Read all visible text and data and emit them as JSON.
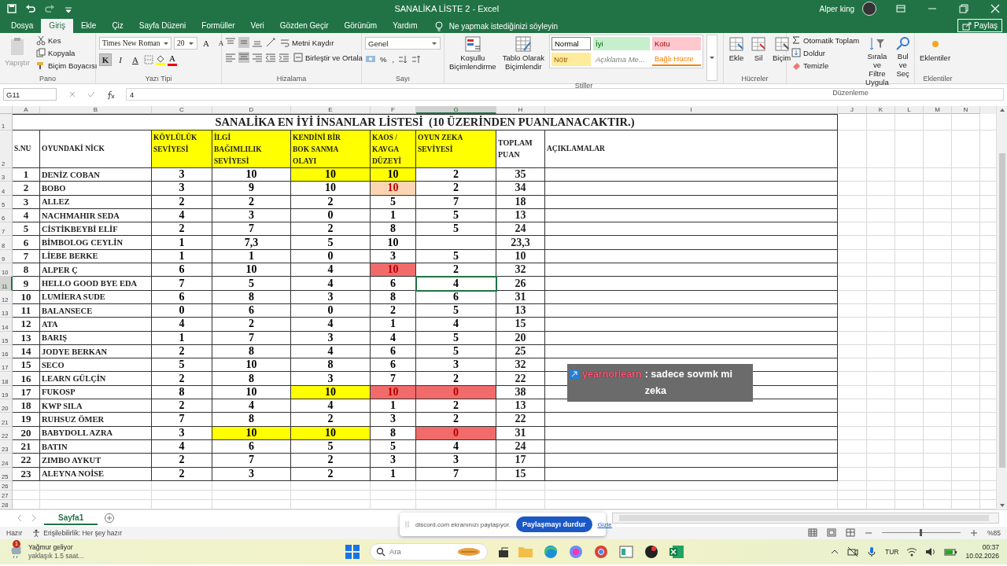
{
  "title_bar": {
    "title": "SANALİKA LİSTE 2  -  Excel",
    "user": "Alper king"
  },
  "ribbon_tabs": [
    {
      "label": "Dosya",
      "selected": false
    },
    {
      "label": "Giriş",
      "selected": true
    },
    {
      "label": "Ekle",
      "selected": false
    },
    {
      "label": "Çiz",
      "selected": false
    },
    {
      "label": "Sayfa Düzeni",
      "selected": false
    },
    {
      "label": "Formüller",
      "selected": false
    },
    {
      "label": "Veri",
      "selected": false
    },
    {
      "label": "Gözden Geçir",
      "selected": false
    },
    {
      "label": "Görünüm",
      "selected": false
    },
    {
      "label": "Yardım",
      "selected": false
    }
  ],
  "tell_me": "Ne yapmak istediğinizi söyleyin",
  "share_button": "Paylaş",
  "ribbon": {
    "clipboard": {
      "label": "Pano",
      "paste": {
        "label": "Yapıştır",
        "disabled": true
      },
      "cut": "Kes",
      "copy": "Kopyala",
      "format_painter": "Biçim Boyacısı"
    },
    "font": {
      "label": "Yazı Tipi",
      "family": "Times New Roman",
      "size": "20",
      "grow": "A",
      "shrink": "A",
      "format_buttons": [
        {
          "label": "K",
          "kind": "bold",
          "pressed": true
        },
        {
          "label": "I",
          "kind": "italic",
          "pressed": false
        },
        {
          "label": "A",
          "kind": "underline",
          "pressed": false
        }
      ],
      "font_color": "A"
    },
    "alignment": {
      "label": "Hizalama",
      "wrap": "Metni Kaydır",
      "merge": "Birleştir ve Ortala"
    },
    "number": {
      "label": "Sayı",
      "format": "Genel",
      "percent": "%",
      "comma": ","
    },
    "styles": {
      "label": "Stiller",
      "conditional": "Koşullu\nBiçimlendirme",
      "table": "Tablo Olarak\nBiçimlendir",
      "gallery": [
        {
          "label": "Normal",
          "kind": "normal"
        },
        {
          "label": "İyi",
          "kind": "good"
        },
        {
          "label": "Kotu",
          "kind": "bad"
        },
        {
          "label": "Nötr",
          "kind": "neutral"
        },
        {
          "label": "Açıklama Me...",
          "kind": "note"
        },
        {
          "label": "Bağlı Hücre",
          "kind": "linked"
        }
      ]
    },
    "cells": {
      "label": "Hücreler",
      "insert": "Ekle",
      "delete": "Sil",
      "format": "Biçim"
    },
    "editing": {
      "label": "Düzenleme",
      "autosum": "Otomatik Toplam",
      "fill": "Doldur",
      "clear": "Temizle",
      "sort": "Sırala ve Filtre\nUygula",
      "find": "Bul ve\nSeç"
    },
    "addins": {
      "label": "Eklentiler",
      "button": "Eklentiler"
    }
  },
  "formula_bar": {
    "name_box": "G11",
    "value": "4"
  },
  "columns": [
    {
      "label": "A",
      "selected": false
    },
    {
      "label": "B",
      "selected": false
    },
    {
      "label": "C",
      "selected": false
    },
    {
      "label": "D",
      "selected": false
    },
    {
      "label": "E",
      "selected": false
    },
    {
      "label": "F",
      "selected": false
    },
    {
      "label": "G",
      "selected": true
    },
    {
      "label": "H",
      "selected": false
    },
    {
      "label": "I",
      "selected": false
    },
    {
      "label": "J",
      "selected": false
    },
    {
      "label": "K",
      "selected": false
    },
    {
      "label": "L",
      "selected": false
    },
    {
      "label": "M",
      "selected": false
    },
    {
      "label": "N",
      "selected": false
    }
  ],
  "row_numbers": [
    {
      "label": "1",
      "selected": false
    },
    {
      "label": "2",
      "selected": false
    },
    {
      "label": "3",
      "selected": false
    },
    {
      "label": "4",
      "selected": false
    },
    {
      "label": "5",
      "selected": false
    },
    {
      "label": "6",
      "selected": false
    },
    {
      "label": "7",
      "selected": false
    },
    {
      "label": "8",
      "selected": false
    },
    {
      "label": "9",
      "selected": false
    },
    {
      "label": "10",
      "selected": false
    },
    {
      "label": "11",
      "selected": true
    },
    {
      "label": "12",
      "selected": false
    },
    {
      "label": "13",
      "selected": false
    },
    {
      "label": "14",
      "selected": false
    },
    {
      "label": "15",
      "selected": false
    },
    {
      "label": "16",
      "selected": false
    },
    {
      "label": "17",
      "selected": false
    },
    {
      "label": "18",
      "selected": false
    },
    {
      "label": "19",
      "selected": false
    },
    {
      "label": "20",
      "selected": false
    },
    {
      "label": "21",
      "selected": false
    },
    {
      "label": "22",
      "selected": false
    },
    {
      "label": "23",
      "selected": false
    },
    {
      "label": "24",
      "selected": false
    },
    {
      "label": "25",
      "selected": false
    },
    {
      "label": "26",
      "selected": false
    },
    {
      "label": "27",
      "selected": false
    },
    {
      "label": "28",
      "selected": false
    }
  ],
  "sheet": {
    "title": "SANALİKA EN İYİ İNSANLAR LİSTESİ  (10 ÜZERİNDEN PUANLANACAKTIR.)",
    "headers": [
      {
        "text": "S.NU"
      },
      {
        "text": "OYUNDAKİ NİCK"
      },
      {
        "text": "KÖYLÜLÜK\nSEVİYESİ",
        "color": "#ffff00"
      },
      {
        "text": "İLGİ\nBAĞIMLILIK\nSEVİYESİ",
        "color": "#ffff00"
      },
      {
        "text": "KENDİNİ BİR\nBOK SANMA\nOLAYI",
        "color": "#ffff00"
      },
      {
        "text": "KAOS /\nKAVGA\nDÜZEYİ",
        "color": "#ffff00"
      },
      {
        "text": "OYUN ZEKA\nSEVİYESİ",
        "color": "#ffff00"
      },
      {
        "text": "TOPLAM\nPUAN"
      },
      {
        "text": "AÇIKLAMALAR"
      }
    ],
    "rows": [
      {
        "no": "1",
        "nick": "DENİZ COBAN",
        "total": "35",
        "scores": [
          {
            "value": "3",
            "selected": false
          },
          {
            "value": "10",
            "selected": false
          },
          {
            "value": "10",
            "color": "#ffff00",
            "selected": false
          },
          {
            "value": "10",
            "color": "#ffff00",
            "selected": false
          },
          {
            "value": "2",
            "selected": false
          }
        ]
      },
      {
        "no": "2",
        "nick": "BOBO",
        "total": "34",
        "scores": [
          {
            "value": "3",
            "selected": false
          },
          {
            "value": "9",
            "selected": false
          },
          {
            "value": "10",
            "selected": false
          },
          {
            "value": "10",
            "color": "#fcd5b4",
            "selected": false
          },
          {
            "value": "2",
            "selected": false
          }
        ]
      },
      {
        "no": "3",
        "nick": "ALLEZ",
        "total": "18",
        "scores": [
          {
            "value": "2",
            "selected": false
          },
          {
            "value": "2",
            "selected": false
          },
          {
            "value": "2",
            "selected": false
          },
          {
            "value": "5",
            "selected": false
          },
          {
            "value": "7",
            "selected": false
          }
        ]
      },
      {
        "no": "4",
        "nick": "NACHMAHIR SEDA",
        "total": "13",
        "scores": [
          {
            "value": "4",
            "selected": false
          },
          {
            "value": "3",
            "selected": false
          },
          {
            "value": "0",
            "selected": false
          },
          {
            "value": "1",
            "selected": false
          },
          {
            "value": "5",
            "selected": false
          }
        ]
      },
      {
        "no": "5",
        "nick": "CİSTİKBEYBİ ELİF",
        "total": "24",
        "scores": [
          {
            "value": "2",
            "selected": false
          },
          {
            "value": "7",
            "selected": false
          },
          {
            "value": "2",
            "selected": false
          },
          {
            "value": "8",
            "selected": false
          },
          {
            "value": "5",
            "selected": false
          }
        ]
      },
      {
        "no": "6",
        "nick": "BİMBOLOG CEYLİN",
        "total": "23,3",
        "scores": [
          {
            "value": "1",
            "selected": false
          },
          {
            "value": "7,3",
            "selected": false
          },
          {
            "value": "5",
            "selected": false
          },
          {
            "value": "10",
            "selected": false
          },
          {
            "selected": false
          }
        ]
      },
      {
        "no": "7",
        "nick": "LİEBE BERKE",
        "total": "10",
        "scores": [
          {
            "value": "1",
            "selected": false
          },
          {
            "value": "1",
            "selected": false
          },
          {
            "value": "0",
            "selected": false
          },
          {
            "value": "3",
            "selected": false
          },
          {
            "value": "5",
            "selected": false
          }
        ]
      },
      {
        "no": "8",
        "nick": "ALPER Ç",
        "total": "32",
        "scores": [
          {
            "value": "6",
            "selected": false
          },
          {
            "value": "10",
            "selected": false
          },
          {
            "value": "4",
            "selected": false
          },
          {
            "value": "10",
            "color": "#f26b6b",
            "selected": false
          },
          {
            "value": "2",
            "selected": false
          }
        ]
      },
      {
        "no": "9",
        "nick": "HELLO GOOD BYE EDA",
        "total": "26",
        "scores": [
          {
            "value": "7",
            "selected": false
          },
          {
            "value": "5",
            "selected": false
          },
          {
            "value": "4",
            "selected": false
          },
          {
            "value": "6",
            "selected": false
          },
          {
            "value": "4",
            "selected": true
          }
        ]
      },
      {
        "no": "10",
        "nick": "LUMİERA SUDE",
        "total": "31",
        "scores": [
          {
            "value": "6",
            "selected": false
          },
          {
            "value": "8",
            "selected": false
          },
          {
            "value": "3",
            "selected": false
          },
          {
            "value": "8",
            "selected": false
          },
          {
            "value": "6",
            "selected": false
          }
        ]
      },
      {
        "no": "11",
        "nick": "BALANSECE",
        "total": "13",
        "scores": [
          {
            "value": "0",
            "selected": false
          },
          {
            "value": "6",
            "selected": false
          },
          {
            "value": "0",
            "selected": false
          },
          {
            "value": "2",
            "selected": false
          },
          {
            "value": "5",
            "selected": false
          }
        ]
      },
      {
        "no": "12",
        "nick": "ATA",
        "total": "15",
        "scores": [
          {
            "value": "4",
            "selected": false
          },
          {
            "value": "2",
            "selected": false
          },
          {
            "value": "4",
            "selected": false
          },
          {
            "value": "1",
            "selected": false
          },
          {
            "value": "4",
            "selected": false
          }
        ]
      },
      {
        "no": "13",
        "nick": "BARIŞ",
        "total": "20",
        "scores": [
          {
            "value": "1",
            "selected": false
          },
          {
            "value": "7",
            "selected": false
          },
          {
            "value": "3",
            "selected": false
          },
          {
            "value": "4",
            "selected": false
          },
          {
            "value": "5",
            "selected": false
          }
        ]
      },
      {
        "no": "14",
        "nick": "JODYE BERKAN",
        "total": "25",
        "scores": [
          {
            "value": "2",
            "selected": false
          },
          {
            "value": "8",
            "selected": false
          },
          {
            "value": "4",
            "selected": false
          },
          {
            "value": "6",
            "selected": false
          },
          {
            "value": "5",
            "selected": false
          }
        ]
      },
      {
        "no": "15",
        "nick": "SECO",
        "total": "32",
        "scores": [
          {
            "value": "5",
            "selected": false
          },
          {
            "value": "10",
            "selected": false
          },
          {
            "value": "8",
            "selected": false
          },
          {
            "value": "6",
            "selected": false
          },
          {
            "value": "3",
            "selected": false
          }
        ]
      },
      {
        "no": "16",
        "nick": "LEARN GÜLÇİN",
        "total": "22",
        "scores": [
          {
            "value": "2",
            "selected": false
          },
          {
            "value": "8",
            "selected": false
          },
          {
            "value": "3",
            "selected": false
          },
          {
            "value": "7",
            "selected": false
          },
          {
            "value": "2",
            "selected": false
          }
        ]
      },
      {
        "no": "17",
        "nick": "FUKOSP",
        "total": "38",
        "scores": [
          {
            "value": "8",
            "selected": false
          },
          {
            "value": "10",
            "selected": false
          },
          {
            "value": "10",
            "color": "#ffff00",
            "selected": false
          },
          {
            "value": "10",
            "color": "#f26b6b",
            "selected": false
          },
          {
            "value": "0",
            "color": "#f26b6b",
            "selected": false
          }
        ]
      },
      {
        "no": "18",
        "nick": "KWP SILA",
        "total": "13",
        "scores": [
          {
            "value": "2",
            "selected": false
          },
          {
            "value": "4",
            "selected": false
          },
          {
            "value": "4",
            "selected": false
          },
          {
            "value": "1",
            "selected": false
          },
          {
            "value": "2",
            "selected": false
          }
        ]
      },
      {
        "no": "19",
        "nick": "RUHSUZ ÖMER",
        "total": "22",
        "scores": [
          {
            "value": "7",
            "selected": false
          },
          {
            "value": "8",
            "selected": false
          },
          {
            "value": "2",
            "selected": false
          },
          {
            "value": "3",
            "selected": false
          },
          {
            "value": "2",
            "selected": false
          }
        ]
      },
      {
        "no": "20",
        "nick": "BABYDOLL AZRA",
        "total": "31",
        "scores": [
          {
            "value": "3",
            "selected": false
          },
          {
            "value": "10",
            "color": "#ffff00",
            "selected": false
          },
          {
            "value": "10",
            "color": "#ffff00",
            "selected": false
          },
          {
            "value": "8",
            "selected": false
          },
          {
            "value": "0",
            "color": "#f26b6b",
            "selected": false
          }
        ]
      },
      {
        "no": "21",
        "nick": "BATIN",
        "total": "24",
        "scores": [
          {
            "value": "4",
            "selected": false
          },
          {
            "value": "6",
            "selected": false
          },
          {
            "value": "5",
            "selected": false
          },
          {
            "value": "5",
            "selected": false
          },
          {
            "value": "4",
            "selected": false
          }
        ]
      },
      {
        "no": "22",
        "nick": "ZIMBO AYKUT",
        "total": "17",
        "scores": [
          {
            "value": "2",
            "selected": false
          },
          {
            "value": "7",
            "selected": false
          },
          {
            "value": "2",
            "selected": false
          },
          {
            "value": "3",
            "selected": false
          },
          {
            "value": "3",
            "selected": false
          }
        ]
      },
      {
        "no": "23",
        "nick": "ALEYNA NOİSE",
        "total": "15",
        "scores": [
          {
            "value": "2",
            "selected": false
          },
          {
            "value": "3",
            "selected": false
          },
          {
            "value": "2",
            "selected": false
          },
          {
            "value": "1",
            "selected": false
          },
          {
            "value": "7",
            "selected": false
          }
        ]
      }
    ]
  },
  "chat_overlay": {
    "user": "yearnorlearn",
    "message": ": sadece sovmk mi zeka"
  },
  "sheet_tabs": [
    {
      "label": "Sayfa1",
      "selected": true
    }
  ],
  "screen_share": {
    "message": "discord.com ekranınızı paylaşıyor.",
    "stop": "Paylaşmayı durdur",
    "hide": "Gizle"
  },
  "status_bar": {
    "ready": "Hazır",
    "accessibility": "Erişilebilirlik: Her şey hazır",
    "zoom_slider": {
      "level": 0.5
    },
    "zoom": "%85"
  },
  "taskbar": {
    "weather_badge": "1",
    "weather": "Yağmur geliyor",
    "weather_detail": "yaklaşık 1.5 saat...",
    "search_placeholder": "Ara",
    "language": "TUR",
    "time": "00:37",
    "date": "10.02.2026"
  }
}
